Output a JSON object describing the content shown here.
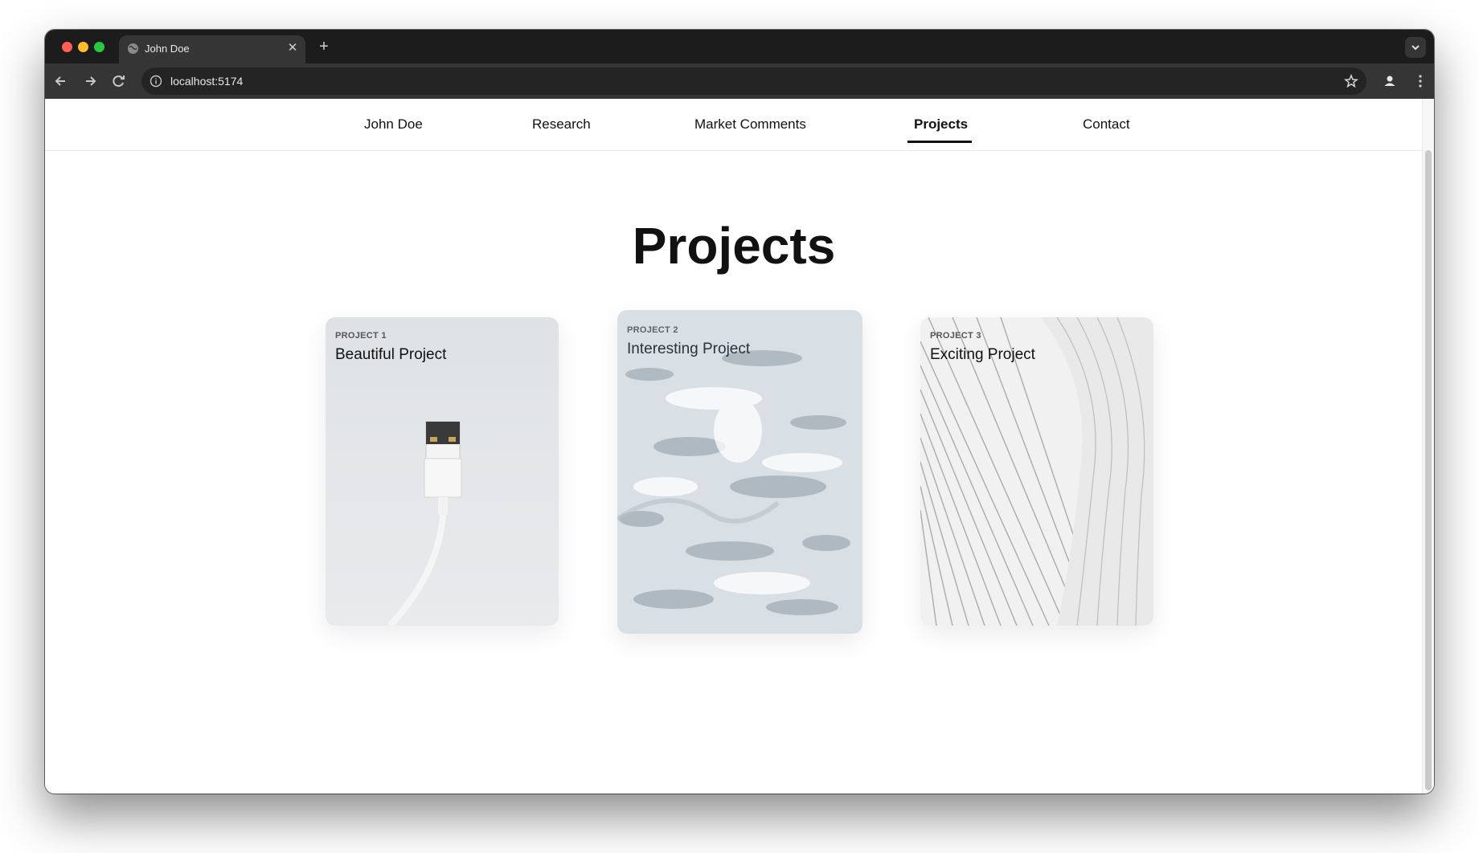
{
  "browser": {
    "tab_title": "John Doe",
    "url": "localhost:5174"
  },
  "site_nav": {
    "items": [
      {
        "label": "John Doe",
        "active": false
      },
      {
        "label": "Research",
        "active": false
      },
      {
        "label": "Market Comments",
        "active": false
      },
      {
        "label": "Projects",
        "active": true
      },
      {
        "label": "Contact",
        "active": false
      }
    ]
  },
  "page": {
    "title": "Projects"
  },
  "projects": [
    {
      "kicker": "PROJECT 1",
      "title": "Beautiful Project",
      "image": "usb-cable-photo"
    },
    {
      "kicker": "PROJECT 2",
      "title": "Interesting Project",
      "image": "ocean-waves-photo"
    },
    {
      "kicker": "PROJECT 3",
      "title": "Exciting Project",
      "image": "white-architecture-lines-photo"
    }
  ]
}
